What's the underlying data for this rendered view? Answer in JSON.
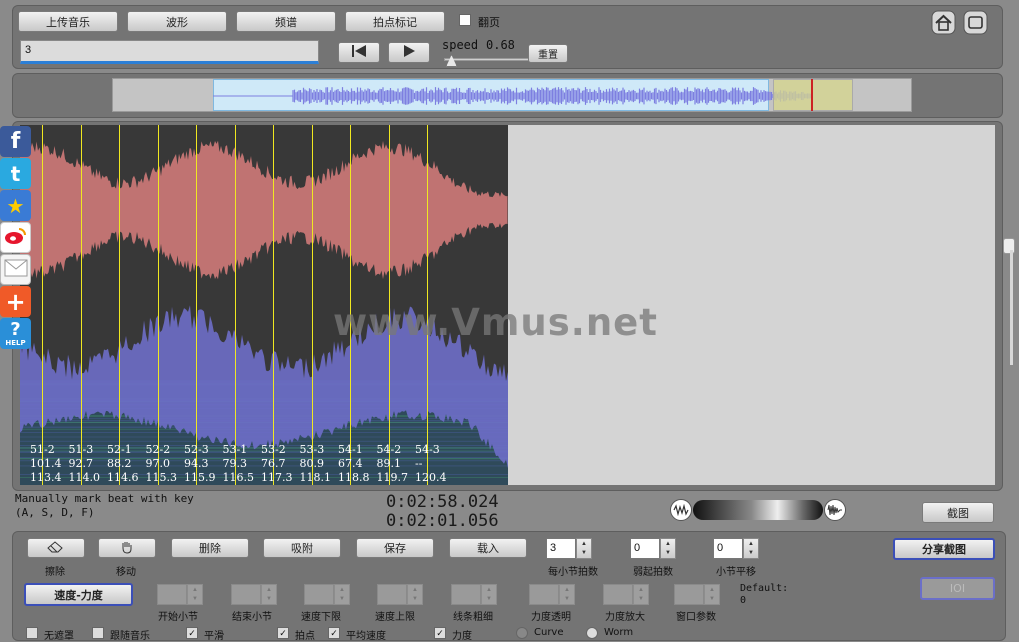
{
  "toolbar": {
    "upload_label": "上传音乐",
    "waveform_label": "波形",
    "spectrum_label": "频谱",
    "beat_mark_label": "拍点标记",
    "flip_label": "翻页",
    "flip_checked": false,
    "home_icon": "home-icon",
    "fullscreen_icon": "fullscreen-icon"
  },
  "transport": {
    "input_value": "3",
    "prev_icon": "skip-to-start-icon",
    "play_icon": "play-icon",
    "speed_label": "speed",
    "speed_value": "0.68",
    "reset_label": "重置"
  },
  "overview": {
    "view_start_fraction": 0.125,
    "view_end_fraction": 0.82,
    "playhead_fraction": 0.873
  },
  "social": [
    "facebook-icon",
    "twitter-icon",
    "favorite-star-icon",
    "weibo-icon",
    "email-icon",
    "add-more-icon",
    "help-icon"
  ],
  "help_text": "HELP",
  "watermark": "www.Vmus.net",
  "beats": [
    {
      "label": "51-2",
      "v1": "101.4",
      "v2": "113.4"
    },
    {
      "label": "51-3",
      "v1": "92.7",
      "v2": "114.0"
    },
    {
      "label": "52-1",
      "v1": "88.2",
      "v2": "114.6"
    },
    {
      "label": "52-2",
      "v1": "97.0",
      "v2": "115.3"
    },
    {
      "label": "52-3",
      "v1": "94.3",
      "v2": "115.9"
    },
    {
      "label": "53-1",
      "v1": "79.3",
      "v2": "116.5"
    },
    {
      "label": "53-2",
      "v1": "76.7",
      "v2": "117.3"
    },
    {
      "label": "53-3",
      "v1": "80.9",
      "v2": "118.1"
    },
    {
      "label": "54-1",
      "v1": "67.4",
      "v2": "118.8"
    },
    {
      "label": "54-2",
      "v1": "89.1",
      "v2": "119.7"
    },
    {
      "label": "54-3",
      "v1": "--",
      "v2": "120.4"
    }
  ],
  "hint": {
    "line1": "Manually mark beat with key",
    "line2": "(A, S, D, F)"
  },
  "time": {
    "current": "0:02:58.024",
    "secondary": "0:02:01.056"
  },
  "screenshot_label": "截图",
  "tools": {
    "erase_label": "擦除",
    "move_label": "移动",
    "delete_label": "删除",
    "snap_label": "吸附",
    "save_label": "保存",
    "load_label": "载入",
    "beats_per_bar_value": "3",
    "beats_per_bar_label": "每小节拍数",
    "pickup_value": "0",
    "pickup_label": "弱起拍数",
    "bar_shift_value": "0",
    "bar_shift_label": "小节平移",
    "share_label": "分享截图",
    "ioi_label": "IOI",
    "mode_label": "速度-力度",
    "start_bar_label": "开始小节",
    "end_bar_label": "结束小节",
    "speed_low_label": "速度下限",
    "speed_high_label": "速度上限",
    "line_width_label": "线条粗细",
    "force_opacity_label": "力度透明",
    "force_zoom_label": "力度放大",
    "window_param_label": "窗口参数",
    "default_label": "Default:",
    "default_value": "0"
  },
  "bottom_options": [
    {
      "label": "无遮罩",
      "type": "checkbox",
      "checked": false
    },
    {
      "label": "跟随音乐",
      "type": "checkbox",
      "checked": false
    },
    {
      "label": "平滑",
      "type": "checkbox",
      "checked": true
    },
    {
      "label": "拍点",
      "type": "checkbox",
      "checked": true
    },
    {
      "label": "平均速度",
      "type": "checkbox",
      "checked": true
    },
    {
      "label": "力度",
      "type": "checkbox",
      "checked": true
    },
    {
      "label": "Curve",
      "type": "radio",
      "checked": true
    },
    {
      "label": "Worm",
      "type": "radio",
      "checked": false
    }
  ],
  "colors": {
    "background": "#8a8a8a",
    "panel": "#747474",
    "waveform_pink": "#c07372",
    "spectrum_blue": "#6e6ec8",
    "beat_line": "#f0e820",
    "playhead": "#cc2222",
    "overview_wave": "#7d7fe0"
  }
}
